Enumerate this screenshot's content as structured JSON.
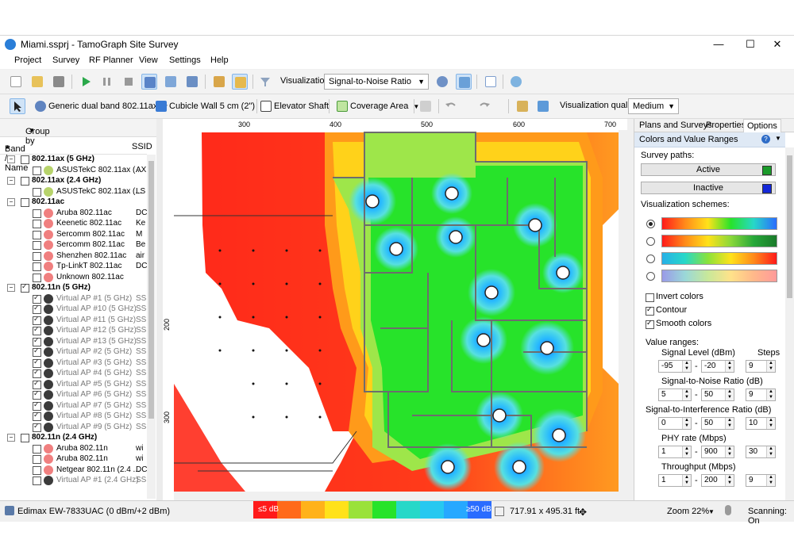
{
  "window": {
    "title": "Miami.ssprj - TamoGraph Site Survey",
    "controls": [
      "—",
      "☐",
      "✕"
    ]
  },
  "menu": [
    "Project",
    "Survey",
    "RF Planner",
    "View",
    "Settings",
    "Help"
  ],
  "toolbar1": {
    "visualization_label": "Visualization:",
    "visualization_value": "Signal-to-Noise Ratio"
  },
  "toolbar2": {
    "adapter": "Generic dual band 802.11ax",
    "wall": "Cubicle Wall 5 cm (2\")",
    "elevator": "Elevator Shaft",
    "coverage": "Coverage Area",
    "quality_label": "Visualization quality:",
    "quality_value": "Medium"
  },
  "left_panel": {
    "group_by": "Group by",
    "col_name": "Band / Name",
    "col_ssid": "SSID",
    "rows": [
      {
        "level": 0,
        "expanded": true,
        "checked": false,
        "text": "802.11ax (5 GHz)",
        "ssid": "",
        "bold": true
      },
      {
        "level": 1,
        "checked": false,
        "text": "ASUSTekC 802.11ax (...",
        "ssid": "AX",
        "icon": "#b7d36b"
      },
      {
        "level": 0,
        "expanded": true,
        "checked": false,
        "text": "802.11ax (2.4 GHz)",
        "ssid": "",
        "bold": true
      },
      {
        "level": 1,
        "checked": false,
        "text": "ASUSTekC 802.11ax (...",
        "ssid": "LS",
        "icon": "#b7d36b"
      },
      {
        "level": 0,
        "expanded": true,
        "checked": false,
        "text": "802.11ac",
        "ssid": "",
        "bold": true
      },
      {
        "level": 1,
        "checked": false,
        "text": "Aruba 802.11ac",
        "ssid": "DC",
        "icon": "#f07f7f"
      },
      {
        "level": 1,
        "checked": false,
        "text": "Keenetic 802.11ac",
        "ssid": "Ke",
        "icon": "#f07f7f"
      },
      {
        "level": 1,
        "checked": false,
        "text": "Sercomm 802.11ac",
        "ssid": "M",
        "icon": "#f07f7f"
      },
      {
        "level": 1,
        "checked": false,
        "text": "Sercomm 802.11ac",
        "ssid": "Be",
        "icon": "#f07f7f"
      },
      {
        "level": 1,
        "checked": false,
        "text": "Shenzhen 802.11ac",
        "ssid": "air",
        "icon": "#f07f7f"
      },
      {
        "level": 1,
        "checked": false,
        "text": "Tp-LinkT 802.11ac",
        "ssid": "DC",
        "icon": "#f07f7f"
      },
      {
        "level": 1,
        "checked": false,
        "text": "Unknown 802.11ac",
        "ssid": "",
        "icon": "#f07f7f"
      },
      {
        "level": 0,
        "expanded": true,
        "checked": true,
        "text": "802.11n (5 GHz)",
        "ssid": "",
        "bold": true
      },
      {
        "level": 1,
        "checked": true,
        "text": "Virtual AP #1 (5 GHz)",
        "ssid": "SS",
        "icon": "#3b3b3b",
        "grey": true
      },
      {
        "level": 1,
        "checked": true,
        "text": "Virtual AP #10 (5 GHz)",
        "ssid": "SS",
        "icon": "#3b3b3b",
        "grey": true
      },
      {
        "level": 1,
        "checked": true,
        "text": "Virtual AP #11 (5 GHz)",
        "ssid": "SS",
        "icon": "#3b3b3b",
        "grey": true
      },
      {
        "level": 1,
        "checked": true,
        "text": "Virtual AP #12 (5 GHz)",
        "ssid": "SS",
        "icon": "#3b3b3b",
        "grey": true
      },
      {
        "level": 1,
        "checked": true,
        "text": "Virtual AP #13 (5 GHz)",
        "ssid": "SS",
        "icon": "#3b3b3b",
        "grey": true
      },
      {
        "level": 1,
        "checked": true,
        "text": "Virtual AP #2 (5 GHz)",
        "ssid": "SS",
        "icon": "#3b3b3b",
        "grey": true
      },
      {
        "level": 1,
        "checked": true,
        "text": "Virtual AP #3 (5 GHz)",
        "ssid": "SS",
        "icon": "#3b3b3b",
        "grey": true
      },
      {
        "level": 1,
        "checked": true,
        "text": "Virtual AP #4 (5 GHz)",
        "ssid": "SS",
        "icon": "#3b3b3b",
        "grey": true
      },
      {
        "level": 1,
        "checked": true,
        "text": "Virtual AP #5 (5 GHz)",
        "ssid": "SS",
        "icon": "#3b3b3b",
        "grey": true
      },
      {
        "level": 1,
        "checked": true,
        "text": "Virtual AP #6 (5 GHz)",
        "ssid": "SS",
        "icon": "#3b3b3b",
        "grey": true
      },
      {
        "level": 1,
        "checked": true,
        "text": "Virtual AP #7 (5 GHz)",
        "ssid": "SS",
        "icon": "#3b3b3b",
        "grey": true
      },
      {
        "level": 1,
        "checked": true,
        "text": "Virtual AP #8 (5 GHz)",
        "ssid": "SS",
        "icon": "#3b3b3b",
        "grey": true
      },
      {
        "level": 1,
        "checked": true,
        "text": "Virtual AP #9 (5 GHz)",
        "ssid": "SS",
        "icon": "#3b3b3b",
        "grey": true
      },
      {
        "level": 0,
        "expanded": true,
        "checked": false,
        "text": "802.11n (2.4 GHz)",
        "ssid": "",
        "bold": true
      },
      {
        "level": 1,
        "checked": false,
        "text": "Aruba 802.11n",
        "ssid": "wi",
        "icon": "#f07f7f"
      },
      {
        "level": 1,
        "checked": false,
        "text": "Aruba 802.11n",
        "ssid": "wi",
        "icon": "#f07f7f"
      },
      {
        "level": 1,
        "checked": false,
        "text": "Netgear 802.11n (2.4 ...",
        "ssid": "DC",
        "icon": "#f07f7f"
      },
      {
        "level": 1,
        "checked": false,
        "text": "Virtual AP #1 (2.4 GHz)",
        "ssid": "SS",
        "icon": "#3b3b3b",
        "grey": true
      }
    ]
  },
  "rulers": {
    "top": [
      "300",
      "400",
      "500",
      "600",
      "700"
    ],
    "left": [
      "200",
      "300"
    ]
  },
  "right_panel": {
    "tabs": [
      "Plans and Surveys",
      "Properties",
      "Options"
    ],
    "section_title": "Colors and Value Ranges",
    "survey_paths_label": "Survey paths:",
    "active_label": "Active",
    "active_color": "#1a9a2a",
    "inactive_label": "Inactive",
    "inactive_color": "#1428d8",
    "schemes_label": "Visualization schemes:",
    "invert_colors": "Invert colors",
    "contour": "Contour",
    "smooth_colors": "Smooth colors",
    "value_ranges": "Value ranges:",
    "steps_label": "Steps",
    "ranges": [
      {
        "label": "Signal Level (dBm)",
        "min": "-95",
        "max": "-20",
        "steps": "9"
      },
      {
        "label": "Signal-to-Noise Ratio (dB)",
        "min": "5",
        "max": "50",
        "steps": "9"
      },
      {
        "label": "Signal-to-Interference Ratio (dB)",
        "min": "0",
        "max": "50",
        "steps": "10"
      },
      {
        "label": "PHY rate (Mbps)",
        "min": "1",
        "max": "900",
        "steps": "30"
      },
      {
        "label": "Throughput (Mbps)",
        "min": "1",
        "max": "200",
        "steps": "9"
      }
    ]
  },
  "statusbar": {
    "adapter": "Edimax EW-7833UAC (0 dBm/+2 dBm)",
    "legend_min": "≤5 dB",
    "legend_max": "≥50 dB",
    "size": "717.91 x 495.31 ft",
    "zoom": "Zoom 22%",
    "scanning": "Scanning: On"
  }
}
